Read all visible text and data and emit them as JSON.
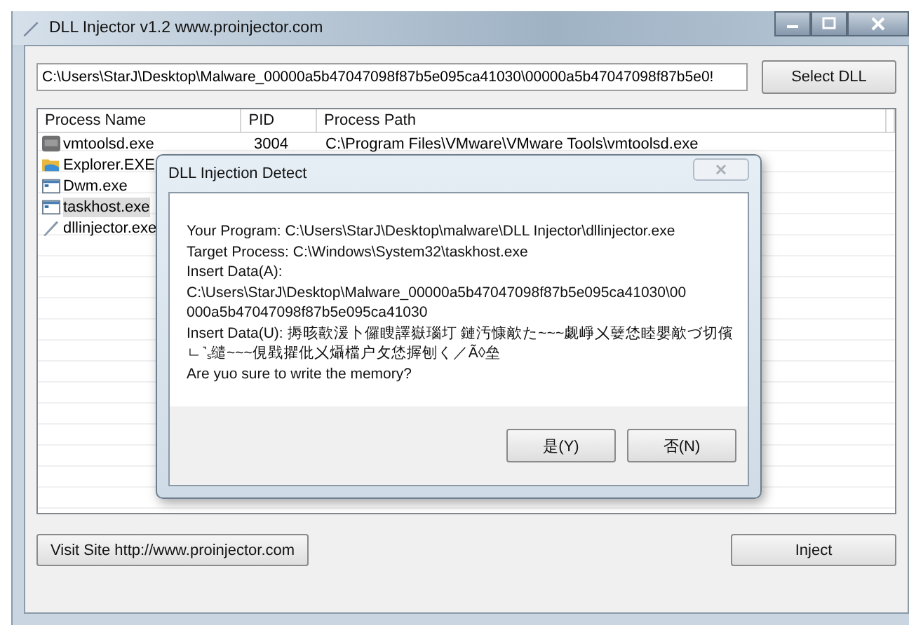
{
  "window": {
    "title": "DLL Injector v1.2  www.proinjector.com"
  },
  "dll_path": {
    "value": "C:\\Users\\StarJ\\Desktop\\Malware_00000a5b47047098f87b5e095ca41030\\00000a5b47047098f87b5e0!"
  },
  "select_button": "Select DLL",
  "table": {
    "columns": [
      "Process Name",
      "PID",
      "Process Path"
    ],
    "rows": [
      {
        "kind": "vm",
        "name": "vmtoolsd.exe",
        "pid": "3004",
        "path": "C:\\Program Files\\VMware\\VMware Tools\\vmtoolsd.exe",
        "selected": false
      },
      {
        "kind": "folder",
        "name": "Explorer.EXE",
        "selected": false
      },
      {
        "kind": "window",
        "name": "Dwm.exe",
        "selected": false
      },
      {
        "kind": "window",
        "name": "taskhost.exe",
        "selected": true
      },
      {
        "kind": "pen",
        "name": "dllinjector.exe",
        "selected": false
      }
    ]
  },
  "dialog": {
    "title": "DLL Injection Detect",
    "lines": [
      "Your Program: C:\\Users\\StarJ\\Desktop\\malware\\DLL Injector\\dllinjector.exe",
      "Target Process: C:\\Windows\\System32\\taskhost.exe",
      "Insert Data(A):",
      "C:\\Users\\StarJ\\Desktop\\Malware_00000a5b47047098f87b5e095ca41030\\00",
      "000a5b47047098f87b5e095ca41030",
      "Insert Data(U): 搙晐歖湲卜儸瞍譯嶽瑙圢 鏈汚慷歒た~~~觑崢㐅㜸恷睦嬰歒づ切儐",
      "ㄴ˺ₛ缱~~~俔戥㩴仳㐅㸎檔户攵恷搱刨く／Ã◊垒",
      "Are yuo sure to write the memory?"
    ],
    "buttons": [
      "是(Y)",
      "否(N)"
    ]
  },
  "visit_button": "Visit Site http://www.proinjector.com",
  "inject_button": "Inject"
}
